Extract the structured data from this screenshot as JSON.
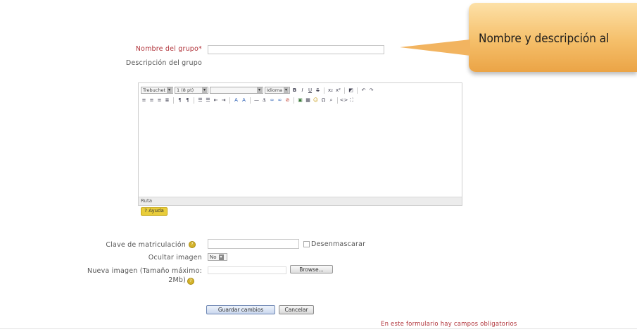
{
  "form": {
    "group_name_label": "Nombre del grupo*",
    "group_name_value": "",
    "group_description_label": "Descripción del grupo",
    "enrolment_key_label": "Clave de matriculación",
    "enrolment_key_value": "",
    "unmask_label": "Desenmascarar",
    "hide_picture_label": "Ocultar imagen",
    "hide_picture_value": "No",
    "new_picture_label_line1": "Nueva imagen (Tamaño máximo:",
    "new_picture_label_line2": "2Mb)",
    "browse_label": "Browse...",
    "save_label": "Guardar cambios",
    "cancel_label": "Cancelar",
    "required_note": "En este formulario hay campos obligatorios"
  },
  "editor": {
    "font_select": "Trebuchet",
    "size_select": "1 (8 pt)",
    "style_select": "",
    "lang_select": "Idioma",
    "status_path": "Ruta",
    "help_chip": "? Ayuda"
  },
  "callout": {
    "text": "Nombre y descripción al"
  },
  "colors": {
    "required": "#b1343b",
    "callout_bg": "#f5bf6a"
  }
}
